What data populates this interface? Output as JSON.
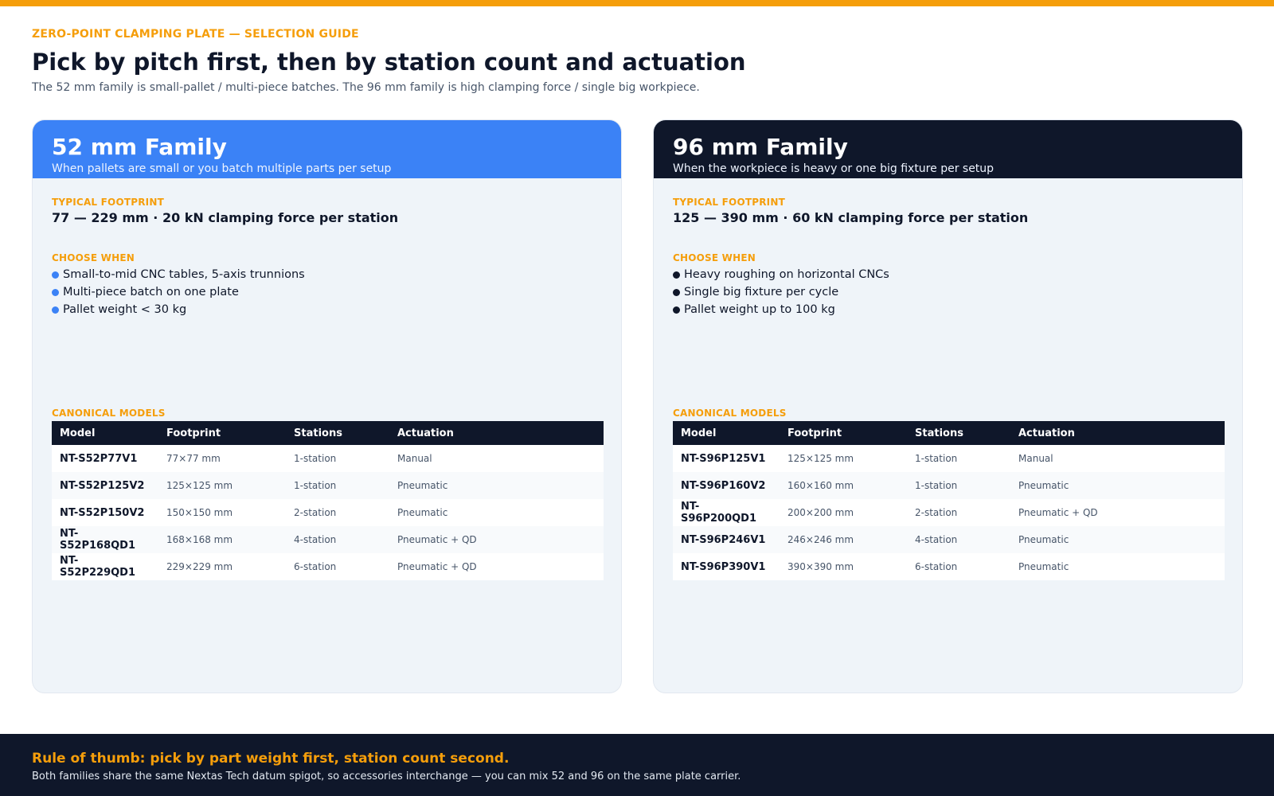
{
  "header": {
    "eyebrow": "ZERO-POINT CLAMPING PLATE — SELECTION GUIDE",
    "title": "Pick by pitch first, then by station count and actuation",
    "subtitle": "The 52 mm family is small-pallet / multi-piece batches. The 96 mm family is high clamping force / single big workpiece."
  },
  "labels": {
    "footprint": "TYPICAL FOOTPRINT",
    "choose_when": "CHOOSE WHEN",
    "models": "CANONICAL MODELS"
  },
  "table_headers": [
    "Model",
    "Footprint",
    "Stations",
    "Actuation"
  ],
  "families": [
    {
      "title": "52 mm Family",
      "subtitle": "When pallets are small or you batch multiple parts per setup",
      "header_color": "#3b82f6",
      "bullet_color": "#3b82f6",
      "footprint": "77 — 229 mm  ·  20 kN clamping force per station",
      "bullets": [
        "Small-to-mid CNC tables, 5-axis trunnions",
        "Multi-piece batch on one plate",
        "Pallet weight < 30 kg"
      ],
      "models": [
        {
          "model": "NT-S52P77V1",
          "footprint": "77×77 mm",
          "stations": "1-station",
          "actuation": "Manual"
        },
        {
          "model": "NT-S52P125V2",
          "footprint": "125×125 mm",
          "stations": "1-station",
          "actuation": "Pneumatic"
        },
        {
          "model": "NT-S52P150V2",
          "footprint": "150×150 mm",
          "stations": "2-station",
          "actuation": "Pneumatic"
        },
        {
          "model": "NT-S52P168QD1",
          "footprint": "168×168 mm",
          "stations": "4-station",
          "actuation": "Pneumatic + QD"
        },
        {
          "model": "NT-S52P229QD1",
          "footprint": "229×229 mm",
          "stations": "6-station",
          "actuation": "Pneumatic + QD"
        }
      ]
    },
    {
      "title": "96 mm Family",
      "subtitle": "When the workpiece is heavy or one big fixture per setup",
      "header_color": "#0f172a",
      "bullet_color": "#0f172a",
      "footprint": "125 — 390 mm  ·  60 kN clamping force per station",
      "bullets": [
        "Heavy roughing on horizontal CNCs",
        "Single big fixture per cycle",
        "Pallet weight up to 100 kg"
      ],
      "models": [
        {
          "model": "NT-S96P125V1",
          "footprint": "125×125 mm",
          "stations": "1-station",
          "actuation": "Manual"
        },
        {
          "model": "NT-S96P160V2",
          "footprint": "160×160 mm",
          "stations": "1-station",
          "actuation": "Pneumatic"
        },
        {
          "model": "NT-S96P200QD1",
          "footprint": "200×200 mm",
          "stations": "2-station",
          "actuation": "Pneumatic + QD"
        },
        {
          "model": "NT-S96P246V1",
          "footprint": "246×246 mm",
          "stations": "4-station",
          "actuation": "Pneumatic"
        },
        {
          "model": "NT-S96P390V1",
          "footprint": "390×390 mm",
          "stations": "6-station",
          "actuation": "Pneumatic"
        }
      ]
    }
  ],
  "footer": {
    "title": "Rule of thumb: pick by part weight first, station count second.",
    "text": "Both families share the same Nextas Tech datum spigot, so accessories interchange — you can mix 52 and 96 on the same plate carrier."
  }
}
